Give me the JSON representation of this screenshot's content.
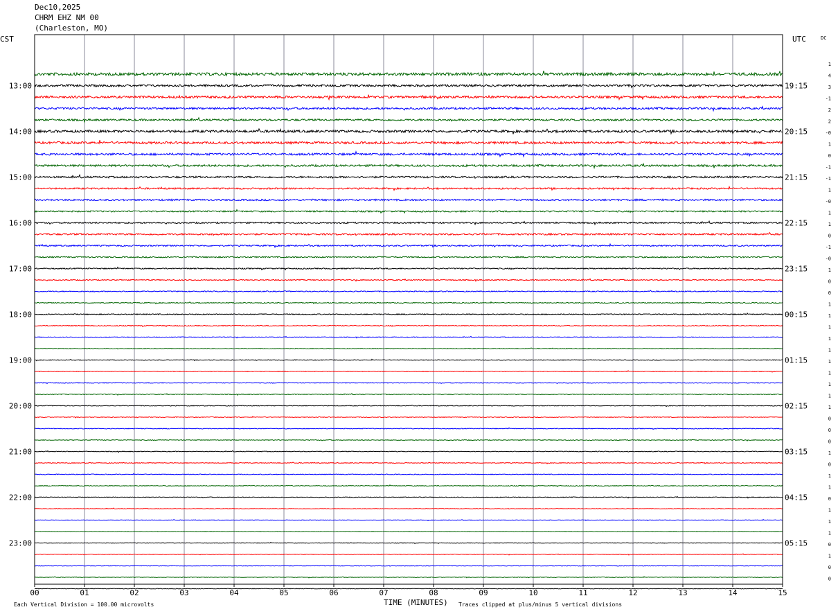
{
  "header": {
    "date": "Dec10,2025",
    "station": "CHRM EHZ NM 00",
    "location": "(Charleston, MO)"
  },
  "axis_labels": {
    "left_timezone": "CST",
    "right_timezone": "UTC",
    "dc_header": "DC",
    "x_title": "TIME (MINUTES)"
  },
  "footer": {
    "scale_note": "Each Vertical Division =  100.00 microvolts",
    "clip_note": "Traces clipped at plus/minus 5 vertical divisions"
  },
  "chart_data": {
    "type": "line",
    "title": "CHRM EHZ NM 00",
    "xlabel": "TIME (MINUTES)",
    "xlim": [
      0,
      15
    ],
    "x_ticks": [
      "00",
      "01",
      "02",
      "03",
      "04",
      "05",
      "06",
      "07",
      "08",
      "09",
      "10",
      "11",
      "12",
      "13",
      "14",
      "15"
    ],
    "trace_minutes": 15,
    "trace_colors": [
      "#006400",
      "#000000",
      "#ff0000",
      "#0000ff"
    ],
    "rows": 46,
    "left_hour_labels": [
      "13:00",
      "14:00",
      "15:00",
      "16:00",
      "17:00",
      "18:00",
      "19:00",
      "20:00",
      "21:00",
      "22:00",
      "23:00"
    ],
    "right_hour_labels": [
      "19:15",
      "20:15",
      "21:15",
      "22:15",
      "23:15",
      "00:15",
      "01:15",
      "02:15",
      "03:15",
      "04:15",
      "05:15"
    ],
    "dc_values": [
      "1",
      "4",
      "3",
      "-1",
      "2",
      "2",
      "-0",
      "1",
      "0",
      "-1",
      "-1",
      "1",
      "-0",
      "1",
      "1",
      "0",
      "-1",
      "-0",
      "1",
      "0",
      "0",
      "1",
      "1",
      "1",
      "1",
      "1",
      "1",
      "1",
      "1",
      "1",
      "1",
      "0",
      "0",
      "0",
      "1",
      "0",
      "1",
      "1",
      "0",
      "1",
      "1",
      "1",
      "0",
      "1",
      "0",
      "0"
    ],
    "activity": [
      2.0,
      1.5,
      1.6,
      1.4,
      1.3,
      1.7,
      1.6,
      1.5,
      1.4,
      1.3,
      1.1,
      1.2,
      1.0,
      1.0,
      1.2,
      1.0,
      0.9,
      0.8,
      0.7,
      0.7,
      0.6,
      0.7,
      0.6,
      0.5,
      0.5,
      0.5,
      0.5,
      0.5,
      0.5,
      0.5,
      0.5,
      0.5,
      0.5,
      0.5,
      0.5,
      0.5,
      0.5,
      0.5,
      0.4,
      0.4,
      0.4,
      0.4,
      0.4,
      0.4,
      0.4,
      0.4
    ]
  }
}
